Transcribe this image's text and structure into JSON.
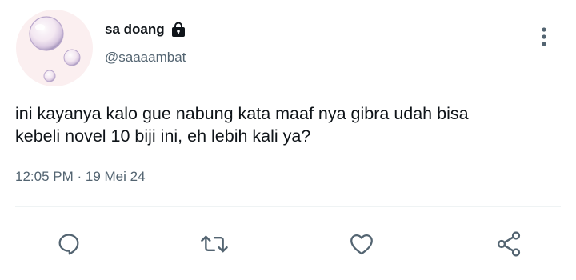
{
  "user": {
    "display_name": "sa doang",
    "handle": "@saaaambat",
    "protected_icon": "lock-icon",
    "avatar": "bubbles-avatar"
  },
  "tweet": {
    "text_lines": [
      "ini kayanya kalo gue nabung kata maaf nya gibra udah bisa",
      "kebeli novel 10 biji ini, eh lebih kali ya?"
    ],
    "time": "12:05 PM",
    "separator": " · ",
    "date": "19 Mei 24"
  },
  "actions": [
    {
      "name": "reply",
      "icon": "reply-icon"
    },
    {
      "name": "retweet",
      "icon": "retweet-icon"
    },
    {
      "name": "like",
      "icon": "heart-icon"
    },
    {
      "name": "share",
      "icon": "share-icon"
    }
  ],
  "menu": {
    "icon": "more-vertical-icon"
  },
  "colors": {
    "primary_text": "#0f1419",
    "secondary_text": "#536471",
    "icon": "#536471",
    "avatar_bg": "#fbeff0",
    "divider": "#eff3f4"
  }
}
